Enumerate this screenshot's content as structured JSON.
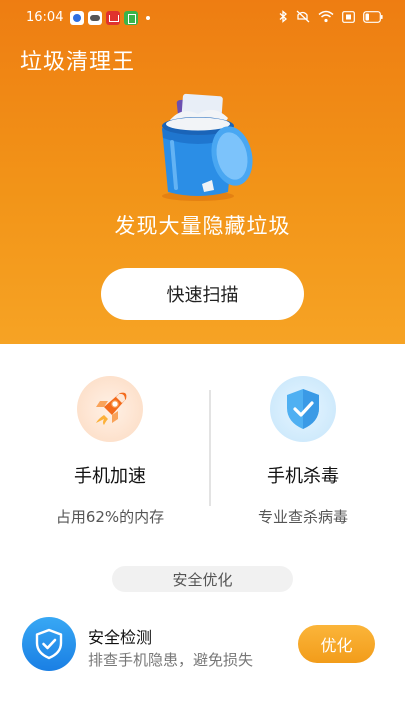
{
  "status_bar": {
    "time": "16:04",
    "app_icons": [
      "baidu-icon",
      "cloud-icon",
      "shopping-cart-icon",
      "green-app-icon"
    ],
    "right_icons": [
      "bluetooth-icon",
      "mute-icon",
      "wifi-icon",
      "sim-icon",
      "battery-icon"
    ]
  },
  "app": {
    "title": "垃圾清理王"
  },
  "hero": {
    "illustration": "trash-bin-icon",
    "message": "发现大量隐藏垃圾",
    "scan_button": "快速扫描"
  },
  "features": [
    {
      "icon": "rocket-icon",
      "title": "手机加速",
      "subtitle": "占用62%的内存"
    },
    {
      "icon": "shield-check-icon",
      "title": "手机杀毒",
      "subtitle": "专业查杀病毒"
    }
  ],
  "section": {
    "label": "安全优化"
  },
  "safety": {
    "icon": "shield-check-icon",
    "title": "安全检测",
    "subtitle": "排查手机隐患，避免损失",
    "button": "优化"
  },
  "colors": {
    "hero_top": "#ee7d12",
    "hero_bottom": "#f6a324",
    "accent_blue": "#1a7fe4",
    "optimize_button": "#f29c1a"
  }
}
